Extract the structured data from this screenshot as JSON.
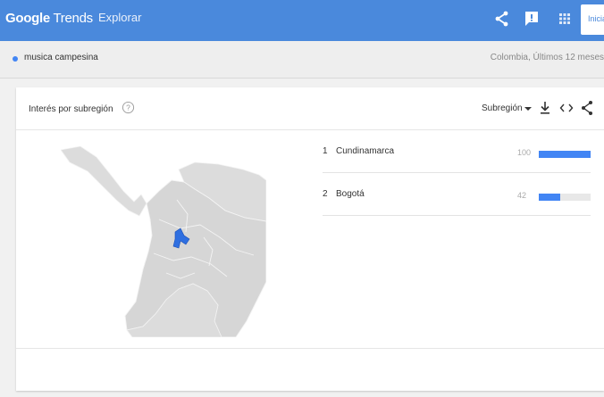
{
  "topbar": {
    "brand_google": "Google",
    "brand_trends": "Trends",
    "explore_label": "Explorar",
    "signin_label": "Inicia",
    "accent_color": "#4a89dc"
  },
  "query": {
    "term": "musica campesina",
    "scope": "Colombia, Últimos 12 meses",
    "dot_color": "#4285f4"
  },
  "card": {
    "title": "Interés por subregión",
    "help_icon": "help-circle-icon",
    "resolution_label": "Subregión",
    "icons": [
      "chevron-down-icon",
      "download-icon",
      "embed-icon",
      "share-icon"
    ]
  },
  "regions": [
    {
      "rank": "1",
      "name": "Cundinamarca",
      "value": "100",
      "fraction": 1.0
    },
    {
      "rank": "2",
      "name": "Bogotá",
      "value": "42",
      "fraction": 0.42
    }
  ]
}
